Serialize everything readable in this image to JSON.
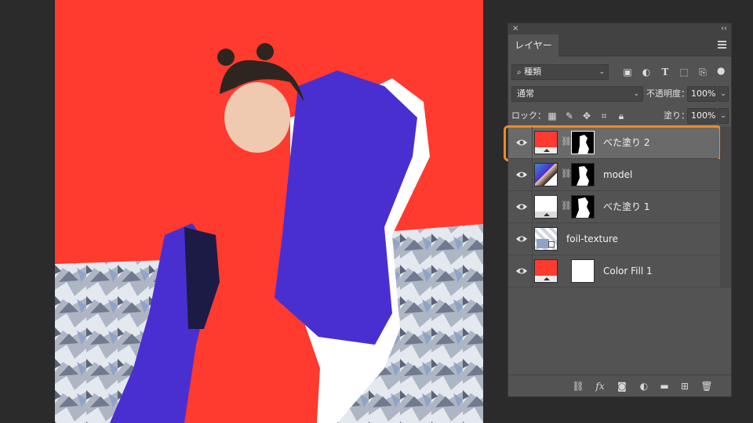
{
  "panel": {
    "close_glyph": "×",
    "collapse_glyph": "‹‹",
    "tab_label": "レイヤー",
    "filter": {
      "label": "種類",
      "icon": "search-icon"
    },
    "blend_mode": "通常",
    "opacity_label": "不透明度：",
    "opacity_value": "100%",
    "lock_label": "ロック：",
    "fill_label": "塗り：",
    "fill_value": "100%",
    "highlight_color": "#f08a24"
  },
  "layers": [
    {
      "name": "べた塗り 2",
      "selected": true,
      "thumb": "red-fill",
      "mask": "silhouette"
    },
    {
      "name": "model",
      "selected": false,
      "thumb": "photo",
      "mask": "silhouette"
    },
    {
      "name": "べた塗り 1",
      "selected": false,
      "thumb": "white-fill",
      "mask": "silhouette"
    },
    {
      "name": "foil-texture",
      "selected": false,
      "thumb": "foil",
      "mask": "none"
    },
    {
      "name": "Color Fill 1",
      "selected": false,
      "thumb": "red-fill",
      "mask": "white"
    }
  ],
  "bottom_icons": [
    "link-icon",
    "fx-icon",
    "mask-icon",
    "adjustment-icon",
    "folder-icon",
    "new-layer-icon",
    "trash-icon"
  ],
  "canvas": {
    "background_color": "#ff3a2f",
    "jacket_color": "#4a2fd0",
    "foil_color": "#b8bfcc"
  }
}
